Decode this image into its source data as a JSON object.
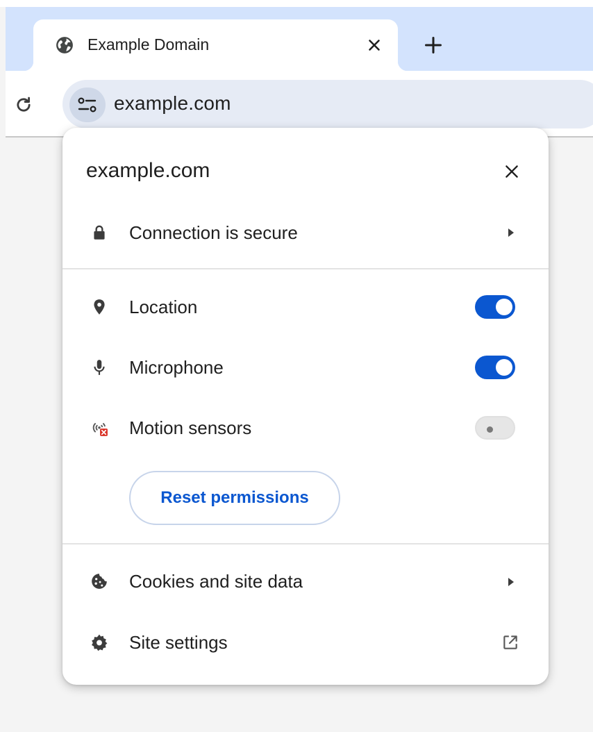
{
  "browser": {
    "tab": {
      "title": "Example Domain",
      "favicon": "globe-icon"
    },
    "new_tab_icon": "plus-icon",
    "reload_icon": "reload-icon",
    "address": "example.com",
    "site_info_icon": "tune-icon"
  },
  "bubble": {
    "title": "example.com",
    "connection": {
      "label": "Connection is secure",
      "icon": "lock-icon"
    },
    "permissions": [
      {
        "label": "Location",
        "icon": "location-pin-icon",
        "enabled": true
      },
      {
        "label": "Microphone",
        "icon": "microphone-icon",
        "enabled": true
      },
      {
        "label": "Motion sensors",
        "icon": "motion-sensors-blocked-icon",
        "enabled": false
      }
    ],
    "reset_label": "Reset permissions",
    "cookies": {
      "label": "Cookies and site data",
      "icon": "cookie-icon"
    },
    "site_settings": {
      "label": "Site settings",
      "icon": "gear-icon"
    }
  },
  "colors": {
    "accent": "#0b57d0",
    "tabstrip": "#d3e3fd",
    "omnibox": "#e6ebf5"
  }
}
